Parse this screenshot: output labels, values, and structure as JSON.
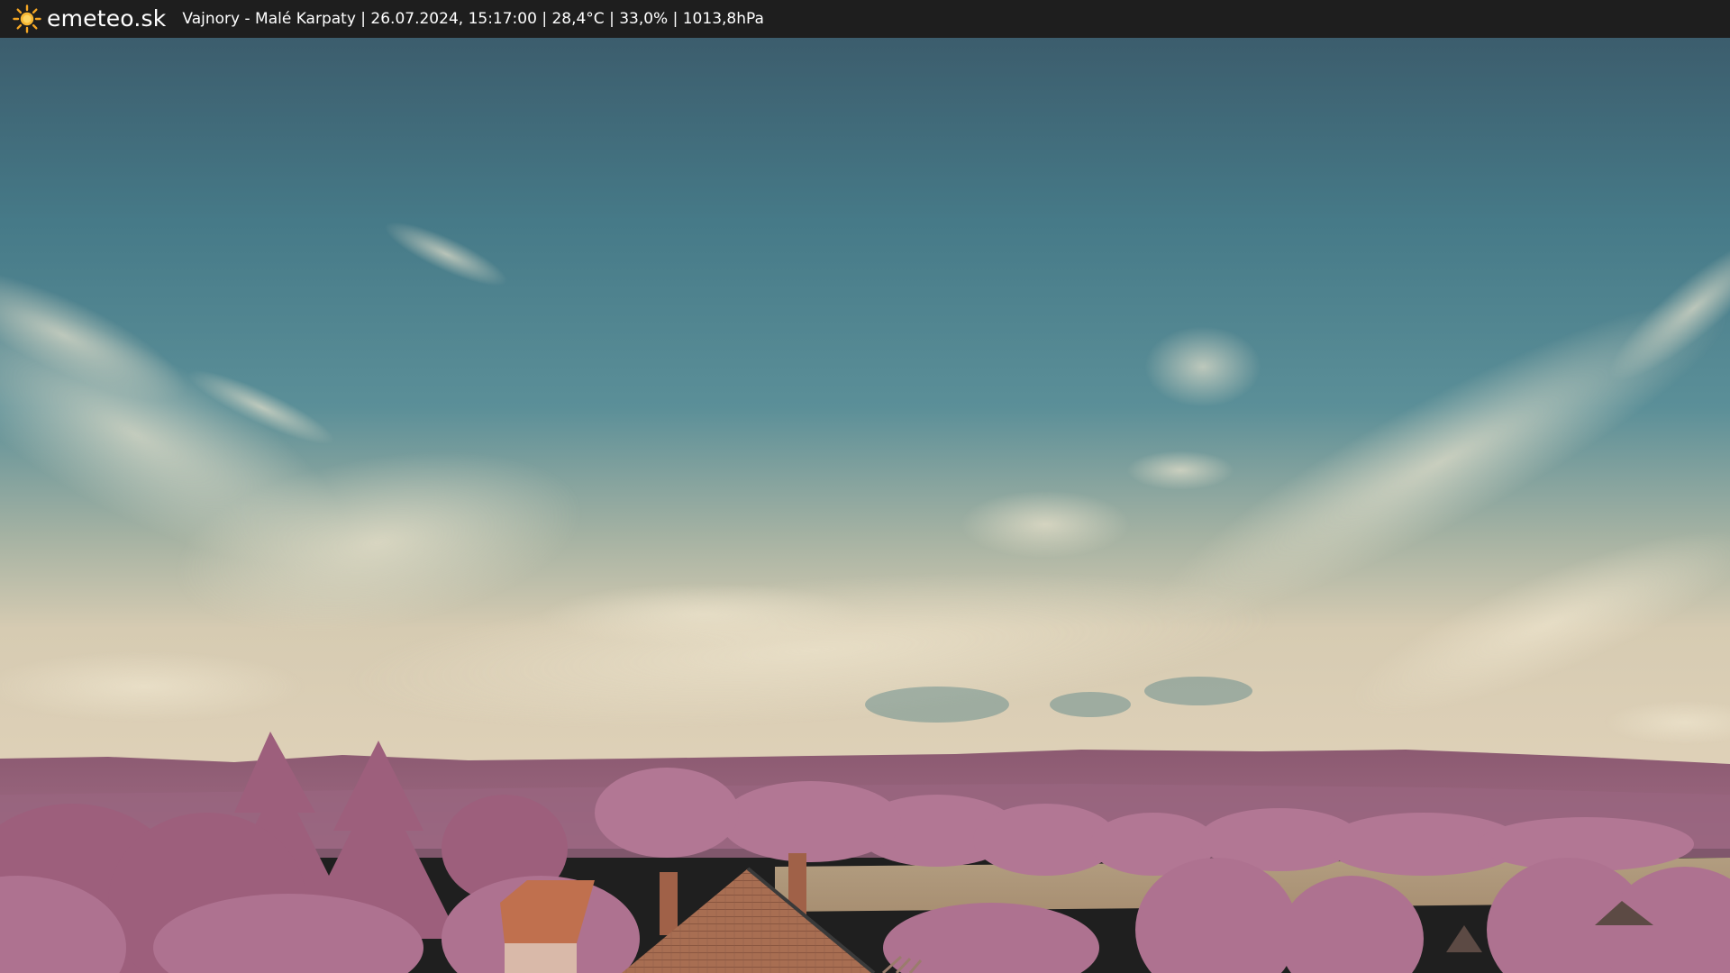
{
  "header": {
    "brand": "emeteo.sk",
    "caption": "Vajnory - Malé Karpaty | 26.07.2024, 15:17:00 | 28,4°C | 33,0% | 1013,8hPa",
    "brand_icon": "sun-icon"
  },
  "colors": {
    "bar_background": "#1e1e1e",
    "sun": "#f5a623",
    "sky_top": "#3f6373",
    "sky_mid": "#4f8a96",
    "sky_horizon": "#d8cdb5",
    "hills": "#8e5a72",
    "vegetation": "#b27a97",
    "roof": "#b46a4a",
    "field": "#b9a384"
  }
}
